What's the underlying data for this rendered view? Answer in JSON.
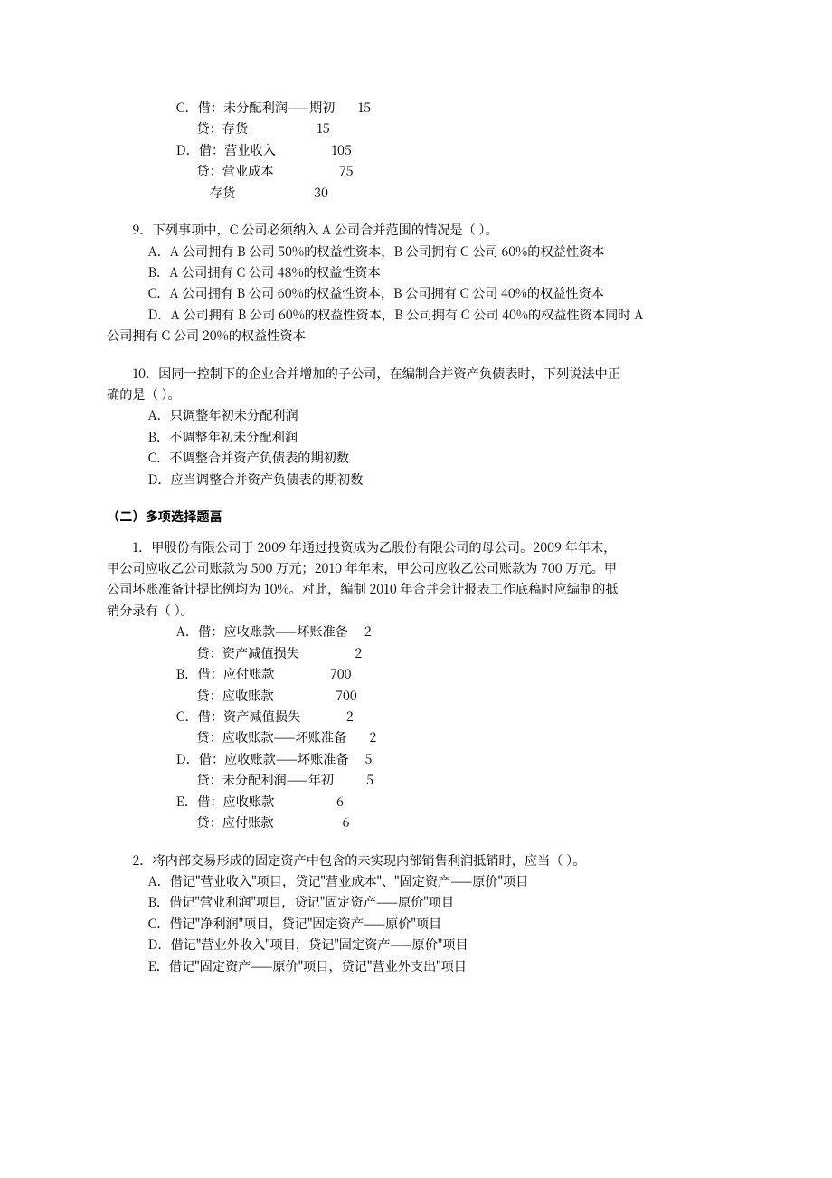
{
  "entryC": {
    "label": "C．",
    "dr": "借：未分配利润——期初",
    "drAmt": "15",
    "cr": "贷：存货",
    "crAmt": "15"
  },
  "entryD": {
    "label": "D．",
    "dr": "借：营业收入",
    "drAmt": "105",
    "cr1": "贷：营业成本",
    "cr1Amt": "75",
    "cr2": "    存货",
    "cr2Amt": "30"
  },
  "q9": {
    "stem": "9．下列事项中，C 公司必须纳入 A 公司合并范围的情况是（  ）。",
    "A": "A．A 公司拥有 B 公司 50%的权益性资本，B 公司拥有 C 公司 60%的权益性资本",
    "B": "B．A 公司拥有 C 公司 48%的权益性资本",
    "C": "C．A 公司拥有 B 公司 60%的权益性资本，B 公司拥有 C 公司 40%的权益性资本",
    "D_line1": "D．A 公司拥有 B 公司 60%的权益性资本，B 公司拥有 C 公司 40%的权益性资本同时 A",
    "D_line2": "公司拥有 C 公司 20%的权益性资本"
  },
  "q10": {
    "stem_line1": "10．因同一控制下的企业合并增加的子公司，在编制合并资产负债表时，下列说法中正",
    "stem_line2": "确的是（  ）。",
    "A": "A．只调整年初未分配利润",
    "B": "B．不调整年初未分配利润",
    "C": "C．不调整合并资产负债表的期初数",
    "D": "D．应当调整合并资产负债表的期初数"
  },
  "section2": "（二）多项选择题畐",
  "m1": {
    "stem_line1": "1．甲股份有限公司于 2009 年通过投资成为乙股份有限公司的母公司。2009 年年末，",
    "stem_line2": "甲公司应收乙公司账款为 500 万元；2010 年年末，甲公司应收乙公司账款为 700 万元。甲",
    "stem_line3": "公司坏账准备计提比例均为 10%。对此，编制 2010 年合并会计报表工作底稿时应编制的抵",
    "stem_line4": "销分录有（  ）。",
    "A": {
      "label": "A．",
      "dr": "借：应收账款——坏账准备",
      "drAmt": "2",
      "cr": "贷：资产减值损失",
      "crAmt": "2"
    },
    "B": {
      "label": "B．",
      "dr": "借：应付账款",
      "drAmt": "700",
      "cr": "贷：应收账款",
      "crAmt": "700"
    },
    "C": {
      "label": "C．",
      "dr": "借：资产减值损失",
      "drAmt": "2",
      "cr": "贷：应收账款——坏账准备",
      "crAmt": "2"
    },
    "D": {
      "label": "D．",
      "dr": "借：应收账款——坏账准备",
      "drAmt": "5",
      "cr": "贷：未分配利润——年初",
      "crAmt": "5"
    },
    "E": {
      "label": "E．",
      "dr": "借：应收账款",
      "drAmt": "6",
      "cr": "贷：应付账款",
      "crAmt": "6"
    }
  },
  "m2": {
    "stem": "2．将内部交易形成的固定资产中包含的未实现内部销售利润抵销时，应当（  ）。",
    "A": "A．借记\"营业收入\"项目，贷记\"营业成本\"、\"固定资产——原价\"项目",
    "B": "B．借记\"营业利润\"项目，贷记\"固定资产——原价\"项目",
    "C": "C．借记\"净利润\"项目，贷记\"固定资产——原价\"项目",
    "D": "D．借记\"营业外收入\"项目，贷记\"固定资产——原价\"项目",
    "E": "E．借记\"固定资产——原价\"项目，贷记\"营业外支出\"项目"
  }
}
